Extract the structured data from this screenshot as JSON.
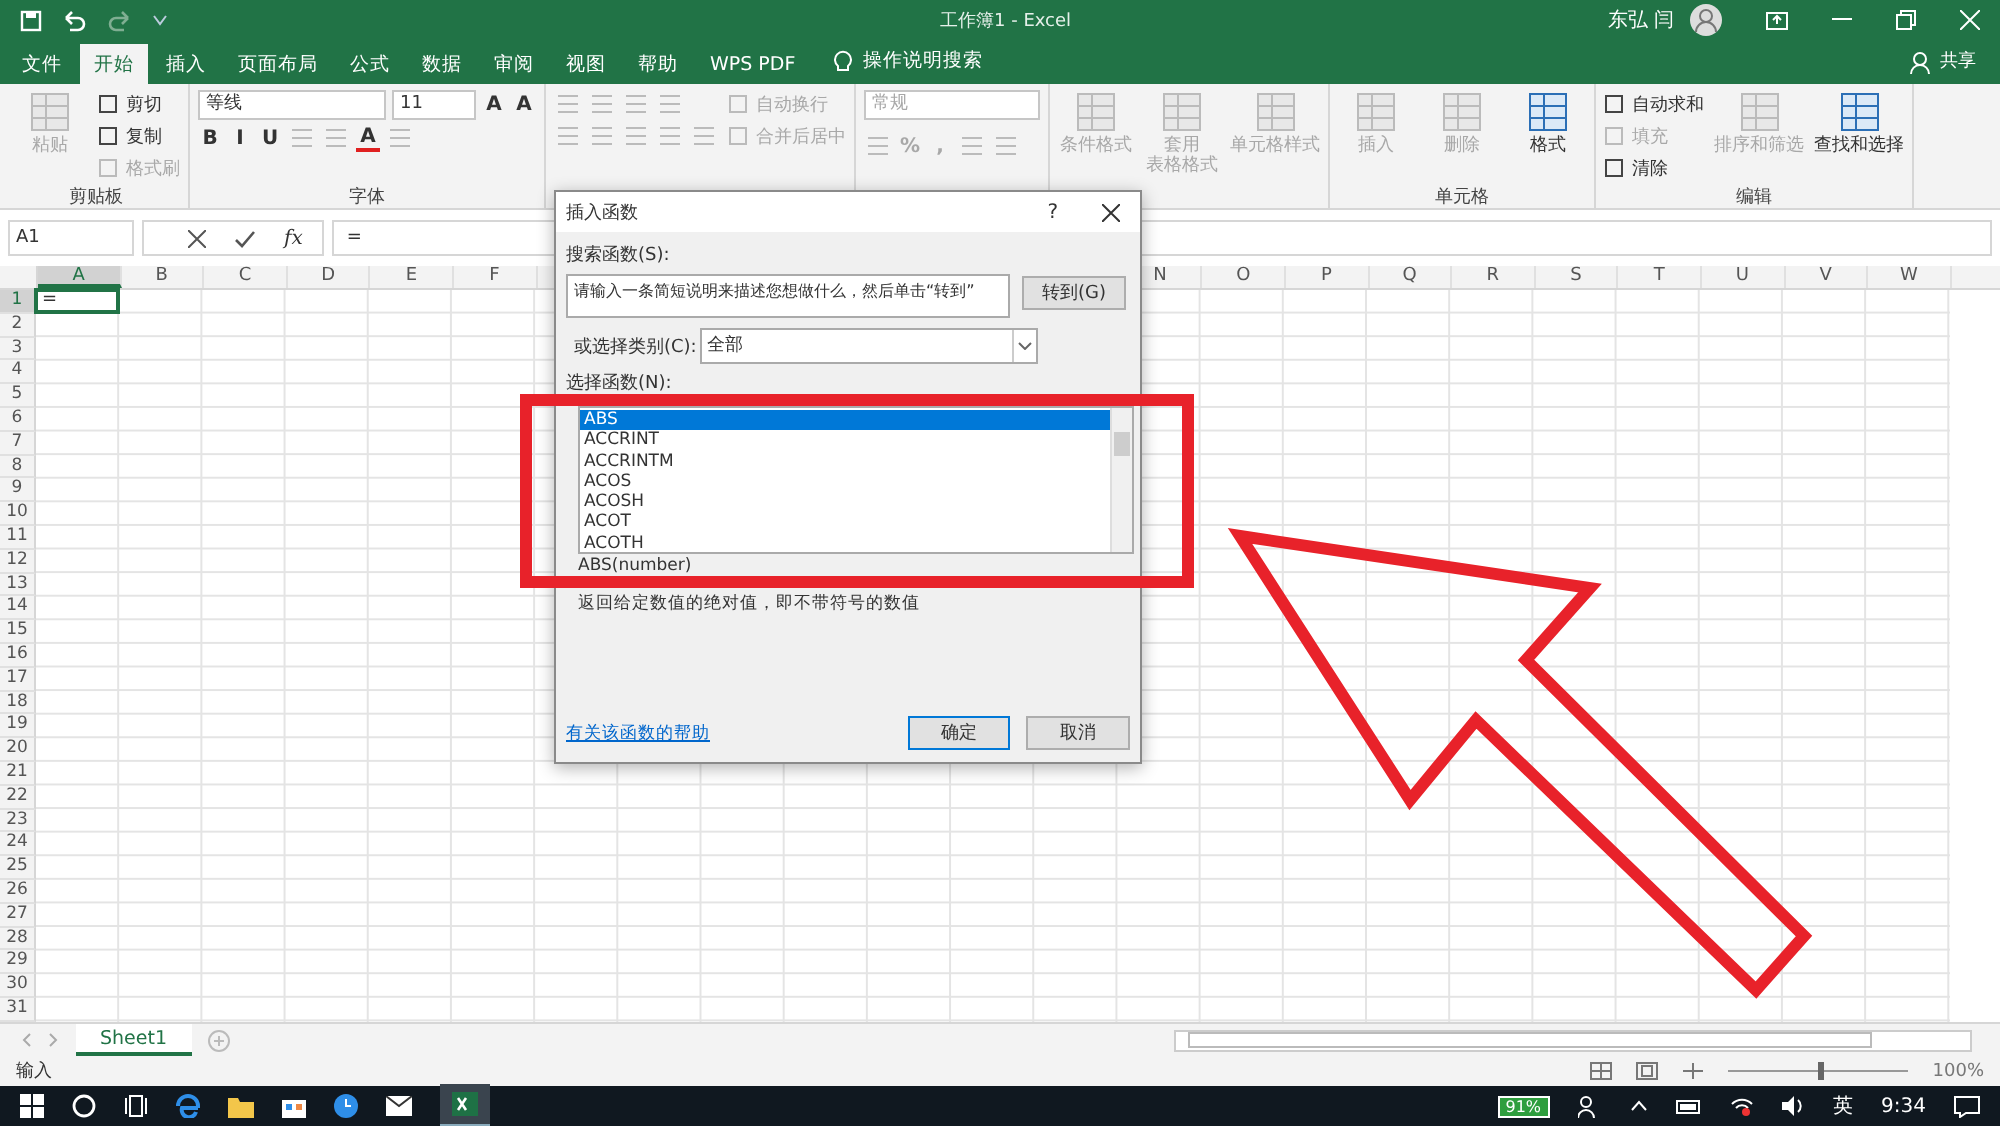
{
  "window": {
    "title": "工作簿1 - Excel",
    "user": "东弘 闫"
  },
  "tabs": [
    {
      "label": "文件",
      "selected": false
    },
    {
      "label": "开始",
      "selected": true
    },
    {
      "label": "插入",
      "selected": false
    },
    {
      "label": "页面布局",
      "selected": false
    },
    {
      "label": "公式",
      "selected": false
    },
    {
      "label": "数据",
      "selected": false
    },
    {
      "label": "审阅",
      "selected": false
    },
    {
      "label": "视图",
      "selected": false
    },
    {
      "label": "帮助",
      "selected": false
    },
    {
      "label": "WPS PDF",
      "selected": false
    }
  ],
  "tell_me": "操作说明搜索",
  "share": "共享",
  "ribbon": [
    {
      "label": "剪贴板",
      "columns": [
        [
          [
            {
              "kind": "big",
              "lines": [
                "粘贴"
              ],
              "disabled": true
            }
          ]
        ],
        [
          [
            {
              "kind": "small",
              "label": "剪切",
              "disabled": false
            }
          ],
          [
            {
              "kind": "small",
              "label": "复制",
              "disabled": false
            }
          ],
          [
            {
              "kind": "small",
              "label": "格式刷",
              "disabled": true
            }
          ]
        ]
      ]
    },
    {
      "label": "字体",
      "columns": [
        [
          [
            {
              "kind": "font-field",
              "value": "等线"
            },
            {
              "kind": "size-field",
              "value": "11"
            },
            {
              "kind": "tool",
              "text": "A",
              "disabled": false
            },
            {
              "kind": "tool",
              "text": "A",
              "disabled": false
            }
          ],
          [
            {
              "kind": "tool",
              "text": "B",
              "disabled": false
            },
            {
              "kind": "tool",
              "text": "I",
              "disabled": false
            },
            {
              "kind": "tool",
              "text": "U",
              "disabled": false
            },
            {
              "kind": "icon",
              "disabled": true
            },
            {
              "kind": "icon",
              "disabled": true
            },
            {
              "kind": "color-tool",
              "text": "A",
              "disabled": false
            },
            {
              "kind": "icon",
              "disabled": true
            }
          ]
        ]
      ]
    },
    {
      "columns": [
        [
          [
            {
              "kind": "icon",
              "disabled": true
            },
            {
              "kind": "icon",
              "disabled": true
            },
            {
              "kind": "icon",
              "disabled": true
            },
            {
              "kind": "icon",
              "disabled": true
            }
          ],
          [
            {
              "kind": "icon",
              "disabled": true
            },
            {
              "kind": "icon",
              "disabled": true
            },
            {
              "kind": "icon",
              "disabled": true
            },
            {
              "kind": "icon",
              "disabled": true
            },
            {
              "kind": "icon",
              "disabled": true
            }
          ]
        ],
        [
          [
            {
              "kind": "small",
              "label": "自动换行",
              "disabled": true
            }
          ],
          [
            {
              "kind": "small",
              "label": "合并后居中",
              "disabled": true
            }
          ]
        ]
      ]
    },
    {
      "columns": [
        [
          [
            {
              "kind": "select",
              "value": "常规",
              "disabled": true
            }
          ],
          [
            {
              "kind": "icon",
              "disabled": true
            },
            {
              "kind": "tool",
              "text": "%",
              "disabled": true
            },
            {
              "kind": "tool",
              "text": ",",
              "disabled": true
            },
            {
              "kind": "icon",
              "disabled": true
            },
            {
              "kind": "icon",
              "disabled": true
            }
          ]
        ]
      ]
    },
    {
      "columns": [
        [
          [
            {
              "kind": "big",
              "lines": [
                "条件格式"
              ],
              "disabled": true
            }
          ]
        ],
        [
          [
            {
              "kind": "big",
              "lines": [
                "套用",
                "表格格式"
              ],
              "disabled": true
            }
          ]
        ],
        [
          [
            {
              "kind": "big",
              "lines": [
                "单元格样式"
              ],
              "disabled": true
            }
          ]
        ]
      ]
    },
    {
      "label": "单元格",
      "columns": [
        [
          [
            {
              "kind": "big",
              "lines": [
                "插入"
              ],
              "disabled": true
            }
          ]
        ],
        [
          [
            {
              "kind": "big",
              "lines": [
                "删除"
              ],
              "disabled": true
            }
          ]
        ],
        [
          [
            {
              "kind": "big",
              "lines": [
                "格式"
              ],
              "disabled": false
            }
          ]
        ]
      ]
    },
    {
      "label": "编辑",
      "columns": [
        [
          [
            {
              "kind": "small",
              "label": "自动求和",
              "disabled": false
            }
          ],
          [
            {
              "kind": "small",
              "label": "填充",
              "disabled": true
            }
          ],
          [
            {
              "kind": "small",
              "label": "清除",
              "disabled": false
            }
          ]
        ],
        [
          [
            {
              "kind": "big",
              "lines": [
                "排序和筛选"
              ],
              "disabled": true
            }
          ]
        ],
        [
          [
            {
              "kind": "big",
              "lines": [
                "查找和选择"
              ],
              "disabled": false
            }
          ]
        ]
      ]
    }
  ],
  "formula_bar": {
    "name_box": "A1",
    "fx": "fx",
    "formula": "="
  },
  "grid": {
    "columns_left": [
      "A",
      "B",
      "C",
      "D",
      "E",
      "F"
    ],
    "columns_right": [
      "N",
      "O",
      "P",
      "Q",
      "R",
      "S",
      "T",
      "U",
      "V",
      "W"
    ],
    "rows": [
      "1",
      "2",
      "3",
      "4",
      "5",
      "6",
      "7",
      "8",
      "9",
      "10",
      "11",
      "12",
      "13",
      "14",
      "15",
      "16",
      "17",
      "18",
      "19",
      "20",
      "21",
      "22",
      "23",
      "24",
      "25",
      "26",
      "27",
      "28",
      "29",
      "30",
      "31"
    ],
    "active_cell": "="
  },
  "sheet_tabs": [
    {
      "label": "Sheet1",
      "selected": true
    }
  ],
  "status_bar": {
    "mode": "输入",
    "level": 0.5,
    "zoom": "100%"
  },
  "taskbar": {
    "battery": "91%",
    "ime": "英",
    "time": "9:34"
  },
  "dialog": {
    "title": "插入函数",
    "help": "?",
    "search_label": "搜索函数(S):",
    "search_value": "请输入一条简短说明来描述您想做什么，然后单击“转到”",
    "go_button": "转到(G)",
    "category_label": "或选择类别(C):",
    "category_value": "全部",
    "list_label": "选择函数(N):",
    "functions": [
      {
        "name": "ABS",
        "selected": true
      },
      {
        "name": "ACCRINT",
        "selected": false
      },
      {
        "name": "ACCRINTM",
        "selected": false
      },
      {
        "name": "ACOS",
        "selected": false
      },
      {
        "name": "ACOSH",
        "selected": false
      },
      {
        "name": "ACOT",
        "selected": false
      },
      {
        "name": "ACOTH",
        "selected": false
      }
    ],
    "signature": "ABS(number)",
    "description": "返回给定数值的绝对值，即不带符号的数值",
    "help_link": "有关该函数的帮助",
    "ok": "确定",
    "cancel": "取消"
  }
}
